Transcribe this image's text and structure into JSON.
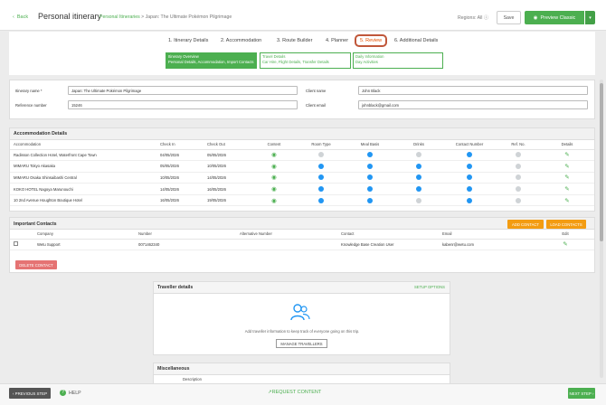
{
  "header": {
    "back": "Back",
    "title": "Personal itinerary",
    "crumb_link": "Personal Itineraries",
    "crumb_rest": "> Japan: The Ultimate Pokémon Pilgrimage",
    "regions": "Regions: All",
    "save": "Save",
    "preview": "Preview Classic"
  },
  "steps": [
    "1. Itinerary Details",
    "2. Accommodation",
    "3. Route Builder",
    "4. Planner",
    "5. Review",
    "6. Additional Details"
  ],
  "subtabs": [
    {
      "line1": "Itinerary Overview",
      "line2": "Personal Details, Accommodation, Import Contacts"
    },
    {
      "line1": "Travel Details",
      "line2": "Car Hire, Flight Details, Transfer Details"
    },
    {
      "line1": "Daily Information",
      "line2": "Day Activities"
    }
  ],
  "details": {
    "name_label": "Itinerary name *",
    "name_value": "Japan: The Ultimate Pokémon Pilgrimage",
    "ref_label": "Reference number",
    "ref_value": "15246",
    "client_label": "Client name",
    "client_value": "John Black",
    "email_label": "Client email",
    "email_value": "johnblack@gmail.com"
  },
  "accommodation": {
    "heading": "Accommodation Details",
    "columns": [
      "Accommodation",
      "Check In",
      "Check Out",
      "Content",
      "Room Type",
      "Meal Basis",
      "Drinks",
      "Contact Number",
      "Ref. No.",
      "Details"
    ],
    "rows": [
      {
        "name": "Radisson Collection Hotel, Waterfront Cape Town",
        "in": "04/05/2026",
        "out": "05/05/2026",
        "flags": [
          false,
          true,
          false,
          true,
          false
        ]
      },
      {
        "name": "MIMARU Tokyo Akasaka",
        "in": "05/05/2026",
        "out": "10/05/2026",
        "flags": [
          true,
          true,
          true,
          true,
          false
        ]
      },
      {
        "name": "MIMARU Osaka Shinsaibashi Central",
        "in": "10/05/2026",
        "out": "14/05/2026",
        "flags": [
          true,
          true,
          true,
          true,
          false
        ]
      },
      {
        "name": "KOKO HOTEL Nagoya Marunouchi",
        "in": "14/05/2026",
        "out": "16/05/2026",
        "flags": [
          true,
          true,
          true,
          true,
          false
        ]
      },
      {
        "name": "10 2nd Avenue Houghton Boutique Hotel",
        "in": "16/05/2026",
        "out": "19/05/2026",
        "flags": [
          true,
          true,
          false,
          true,
          false
        ]
      }
    ]
  },
  "contacts": {
    "heading": "Important Contacts",
    "add": "ADD CONTACT",
    "load": "LOAD CONTACTS",
    "columns": [
      "Company",
      "Number",
      "Alternative Number",
      "Contact",
      "Email",
      "Edit"
    ],
    "rows": [
      {
        "company": "Wetu Support",
        "number": "0071462340",
        "alt": "",
        "contact": "Knowledge Base Creation User",
        "email": "kabenr@wetu.com"
      }
    ],
    "delete": "DELETE CONTACT"
  },
  "traveller": {
    "heading": "Traveller details",
    "setup": "SETUP OPTIONS",
    "message": "Add traveller information to keep track of everyone going on this trip.",
    "manage": "MANAGE TRAVELLERS"
  },
  "misc": {
    "heading": "Miscellaneous",
    "col": "Description"
  },
  "footer": {
    "prev": "PREVIOUS STEP",
    "help": "HELP",
    "request": "REQUEST CONTENT",
    "next": "NEXT STEP"
  },
  "colors": {
    "accent": "#4caf50",
    "orange": "#f39c12",
    "blue": "#2196f3",
    "danger": "#e57373"
  }
}
